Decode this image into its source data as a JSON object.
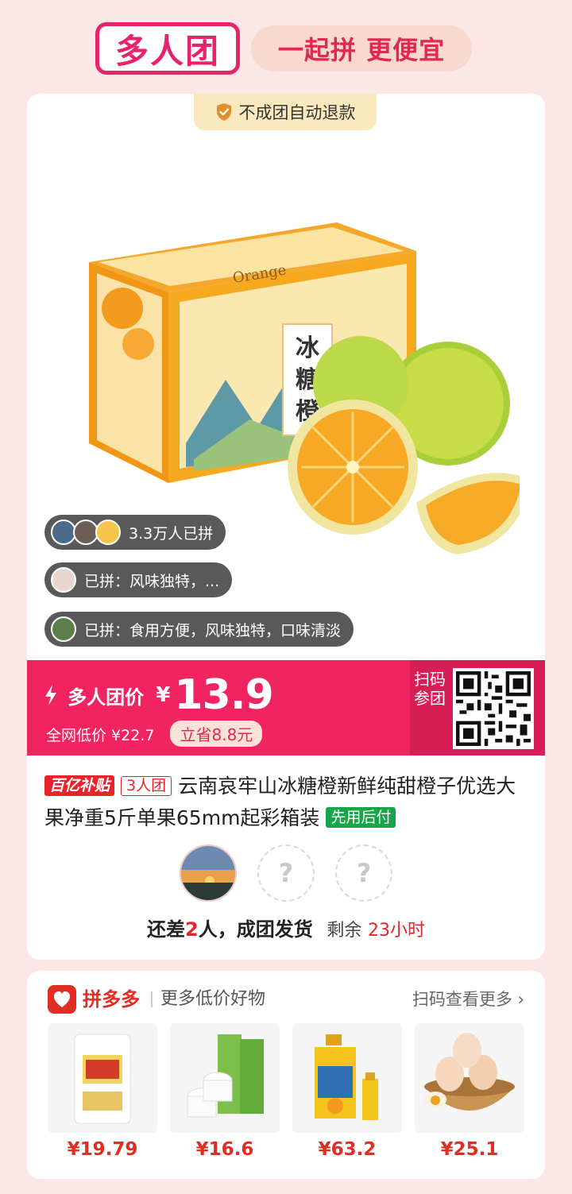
{
  "header": {
    "logo_text": "多人团",
    "slogan": "一起拼 更便宜"
  },
  "card": {
    "refund_badge": "不成团自动退款",
    "social": {
      "joined_count": "3.3万人已拼",
      "review1": "已拼：风味独特，...",
      "review2": "已拼：食用方便，风味独特，口味清淡"
    },
    "price_bar": {
      "group_label": "多人团价",
      "currency": "¥",
      "price": "13.9",
      "market_price": "全网低价 ¥22.7",
      "save": "立省8.8元",
      "scan_label": "扫码参团"
    },
    "title": {
      "tag_subsidy": "百亿补贴",
      "tag_group": "3人团",
      "text": "云南哀牢山冰糖橙新鲜纯甜橙子优选大果净重5斤单果65mm起彩箱装",
      "tag_bnpl": "先用后付"
    },
    "slots": {
      "empty_mark": "?"
    },
    "status": {
      "prefix": "还差",
      "count": "2",
      "suffix": "人，成团发货",
      "remain_label": "剩余",
      "remain_time": "23小时"
    }
  },
  "more": {
    "brand": "拼多多",
    "subtitle": "更多低价好物",
    "scan_more": "扫码查看更多 ›",
    "products": [
      {
        "icon": "flour-bag",
        "price": "¥19.79"
      },
      {
        "icon": "tissue-rolls",
        "price": "¥16.6"
      },
      {
        "icon": "cooking-oil",
        "price": "¥63.2"
      },
      {
        "icon": "eggs-basket",
        "price": "¥25.1"
      }
    ]
  },
  "colors": {
    "accent": "#ef2461",
    "brand_red": "#e02e24",
    "page_bg": "#fbe8e6"
  }
}
